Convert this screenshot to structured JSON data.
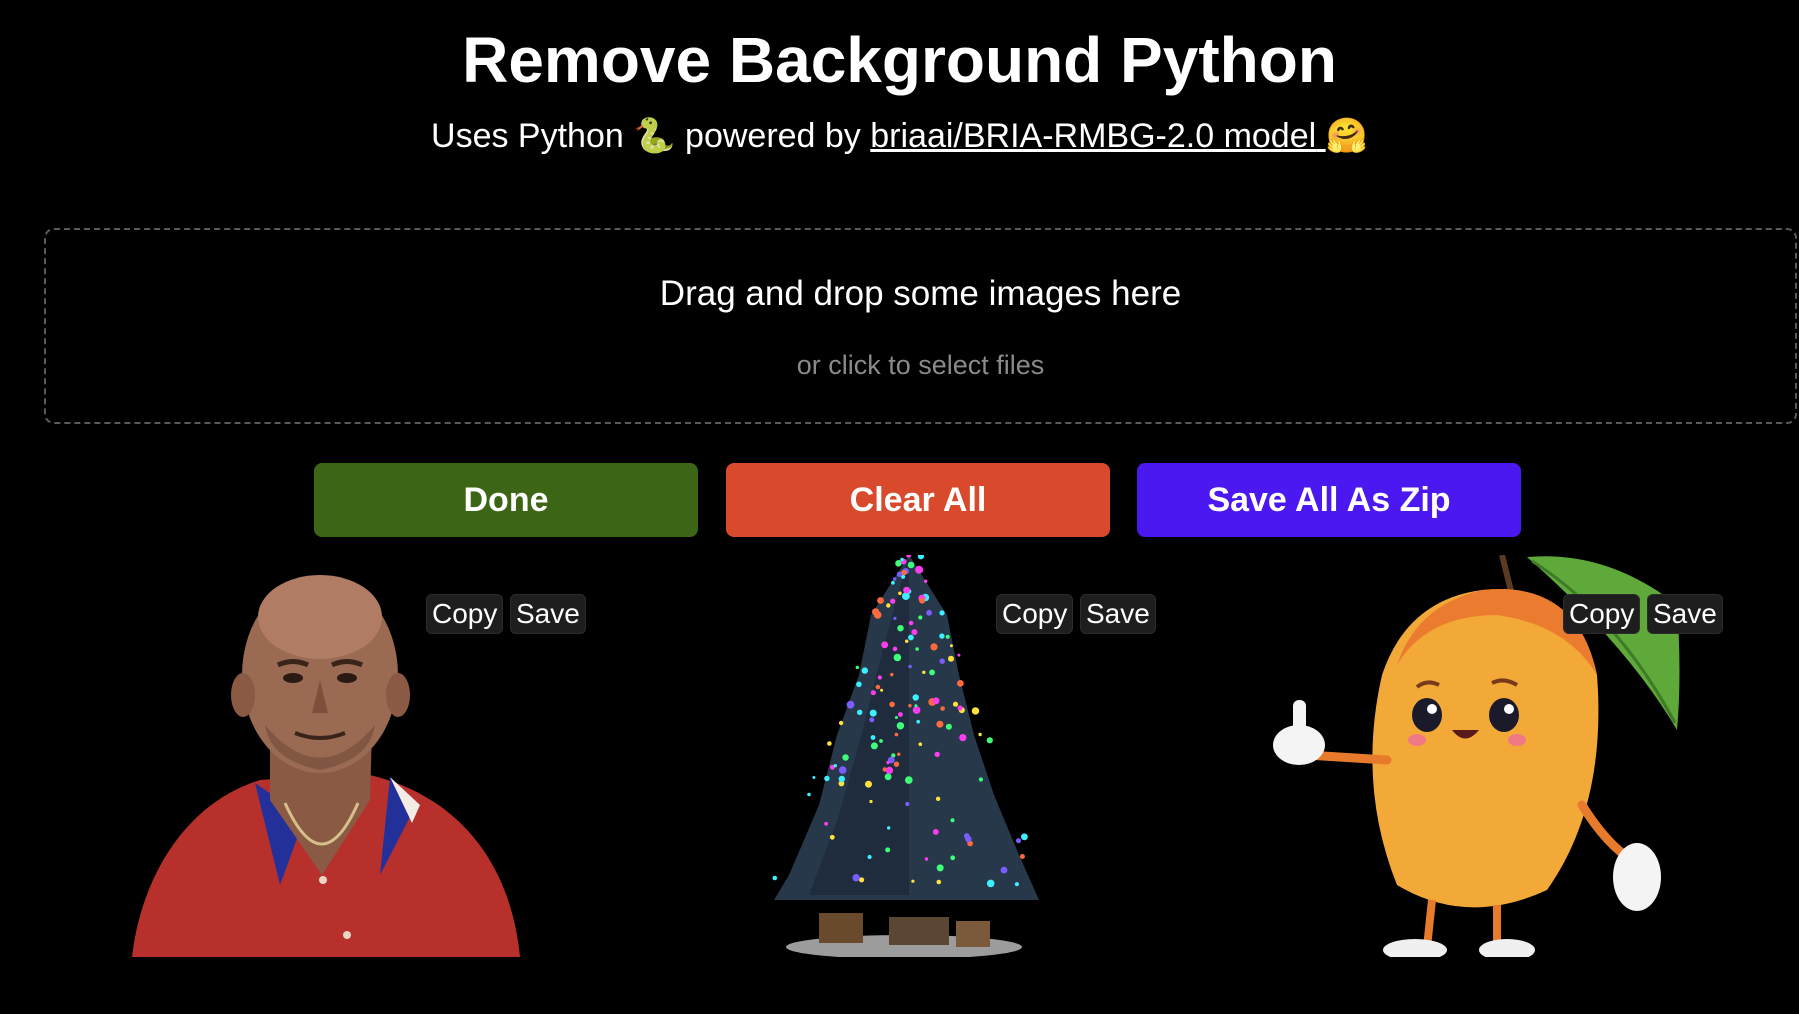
{
  "header": {
    "title": "Remove Background Python",
    "subtitle_prefix": "Uses Python",
    "python_emoji": "🐍",
    "subtitle_mid": "powered by",
    "model_link": "briaai/BRIA-RMBG-2.0 model",
    "hug_emoji": "🤗"
  },
  "dropzone": {
    "main_text": "Drag and drop some images here",
    "sub_text": "or click to select files"
  },
  "actions": {
    "done_label": "Done",
    "clear_label": "Clear All",
    "zip_label": "Save All As Zip"
  },
  "colors": {
    "done": "#3d6516",
    "clear": "#d9492b",
    "zip": "#4b18f2",
    "background": "#000000"
  },
  "results": [
    {
      "subject": "person-photo",
      "copy_label": "Copy",
      "save_label": "Save"
    },
    {
      "subject": "christmas-tree",
      "copy_label": "Copy",
      "save_label": "Save"
    },
    {
      "subject": "mango-character",
      "copy_label": "Copy",
      "save_label": "Save"
    }
  ]
}
